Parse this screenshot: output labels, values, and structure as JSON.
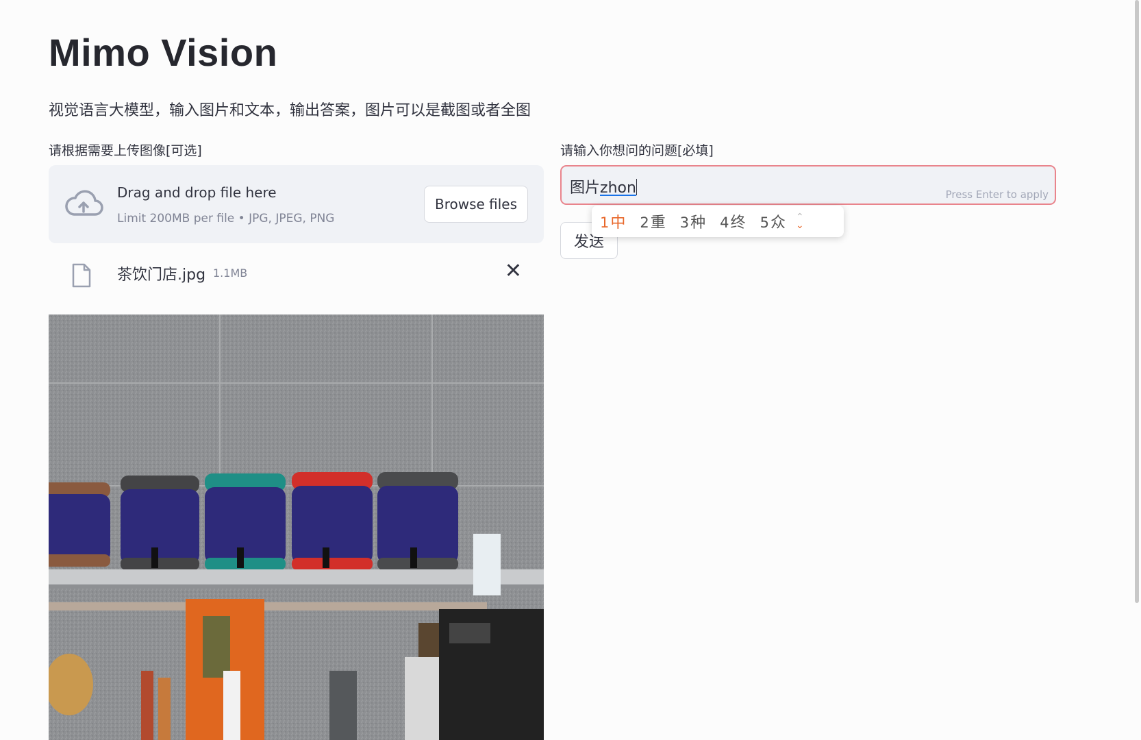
{
  "app": {
    "title": "Mimo Vision",
    "subtitle": "视觉语言大模型，输入图片和文本，输出答案，图片可以是截图或者全图"
  },
  "uploader": {
    "label": "请根据需要上传图像[可选]",
    "drop_title": "Drag and drop file here",
    "drop_limit": "Limit 200MB per file • JPG, JPEG, PNG",
    "browse_label": "Browse files",
    "file": {
      "name": "茶饮门店.jpg",
      "size": "1.1MB"
    }
  },
  "question": {
    "label": "请输入你想问的问题[必填]",
    "value_committed": "图片",
    "value_composing": "zhon",
    "hint": "Press Enter to apply",
    "send_label": "发送"
  },
  "ime": {
    "candidates": [
      {
        "num": "1",
        "text": "中"
      },
      {
        "num": "2",
        "text": "重"
      },
      {
        "num": "3",
        "text": "种"
      },
      {
        "num": "4",
        "text": "终"
      },
      {
        "num": "5",
        "text": "众"
      }
    ]
  },
  "colors": {
    "input_border_focus": "#e9848c",
    "ime_highlight": "#e8672a",
    "dropzone_bg": "#f0f2f6"
  }
}
